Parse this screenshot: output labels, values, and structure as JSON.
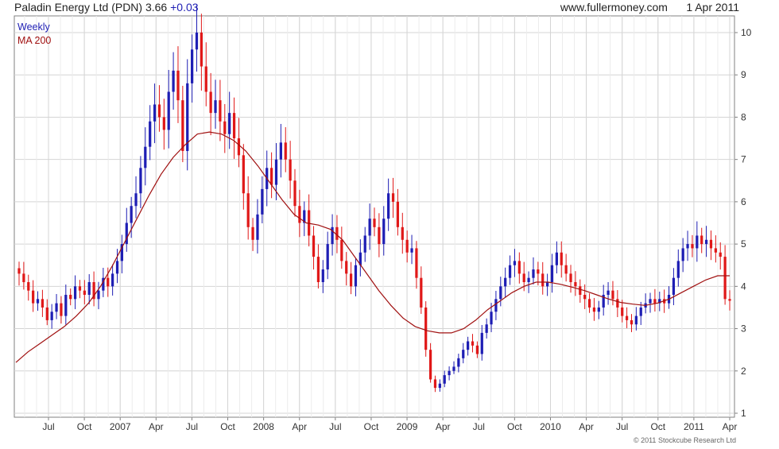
{
  "header": {
    "title": "Paladin Energy Ltd (PDN) 3.66",
    "change": "+0.03",
    "site": "www.fullermoney.com",
    "date": "1 Apr 2011"
  },
  "legend": {
    "weekly": "Weekly",
    "ma": "MA 200"
  },
  "copyright": "© 2011 Stockcube Research Ltd",
  "colors": {
    "up": "#1e1eb4",
    "down": "#e01818",
    "ma": "#a01010",
    "grid": "#d4d4d4",
    "frame": "#808080"
  },
  "chart_data": {
    "type": "candlestick",
    "x_range": [
      "2006-04",
      "2011-04"
    ],
    "ylim": [
      1,
      10
    ],
    "y_ticks": [
      1,
      2,
      3,
      4,
      5,
      6,
      7,
      8,
      9,
      10
    ],
    "x_tick_labels": [
      "Jul",
      "Oct",
      "2007",
      "Apr",
      "Jul",
      "Oct",
      "2008",
      "Apr",
      "Jul",
      "Oct",
      "2009",
      "Apr",
      "Jul",
      "Oct",
      "2010",
      "Apr",
      "Jul",
      "Oct",
      "2011",
      "Apr"
    ],
    "series": [
      {
        "name": "Weekly",
        "style": "candles",
        "closes": [
          4.3,
          4.1,
          3.9,
          3.6,
          3.7,
          3.5,
          3.2,
          3.4,
          3.6,
          3.3,
          3.8,
          3.7,
          4.0,
          3.9,
          3.8,
          4.1,
          3.7,
          3.9,
          4.2,
          4.0,
          4.3,
          4.6,
          5.0,
          5.5,
          5.9,
          6.2,
          6.8,
          7.3,
          7.9,
          8.3,
          8.0,
          7.7,
          8.6,
          9.1,
          8.4,
          7.2,
          8.8,
          9.6,
          10.0,
          9.2,
          8.6,
          8.1,
          8.4,
          7.9,
          7.6,
          8.1,
          7.5,
          7.1,
          6.2,
          5.4,
          5.1,
          5.7,
          6.3,
          6.8,
          6.4,
          7.0,
          7.4,
          7.0,
          6.5,
          5.9,
          5.5,
          5.8,
          5.2,
          4.7,
          4.1,
          4.4,
          5.0,
          5.4,
          5.1,
          4.6,
          4.3,
          4.0,
          4.5,
          4.8,
          5.2,
          5.6,
          5.4,
          5.0,
          5.6,
          6.2,
          6.0,
          5.4,
          5.1,
          4.8,
          4.9,
          4.2,
          3.5,
          2.5,
          1.8,
          1.6,
          1.7,
          1.9,
          2.0,
          2.1,
          2.3,
          2.5,
          2.7,
          2.6,
          2.4,
          2.9,
          3.1,
          3.4,
          3.7,
          4.0,
          4.2,
          4.5,
          4.6,
          4.3,
          4.1,
          4.2,
          4.4,
          4.3,
          4.0,
          4.1,
          4.5,
          4.8,
          4.5,
          4.3,
          4.1,
          4.0,
          3.8,
          3.7,
          3.5,
          3.4,
          3.5,
          3.8,
          3.9,
          3.7,
          3.5,
          3.3,
          3.2,
          3.1,
          3.3,
          3.5,
          3.6,
          3.7,
          3.6,
          3.7,
          3.6,
          3.8,
          4.2,
          4.6,
          4.9,
          5.0,
          4.9,
          5.2,
          5.0,
          5.1,
          4.9,
          4.8,
          4.7,
          3.7,
          3.66
        ]
      },
      {
        "name": "MA 200",
        "style": "line",
        "values": [
          2.2,
          2.45,
          2.65,
          2.85,
          3.05,
          3.3,
          3.6,
          4.0,
          4.5,
          5.05,
          5.6,
          6.15,
          6.65,
          7.05,
          7.35,
          7.6,
          7.65,
          7.6,
          7.45,
          7.2,
          6.85,
          6.45,
          6.05,
          5.7,
          5.5,
          5.45,
          5.35,
          5.1,
          4.7,
          4.3,
          3.9,
          3.55,
          3.25,
          3.05,
          2.95,
          2.9,
          2.9,
          3.0,
          3.2,
          3.45,
          3.65,
          3.85,
          4.0,
          4.1,
          4.1,
          4.05,
          3.98,
          3.9,
          3.8,
          3.7,
          3.62,
          3.58,
          3.55,
          3.6,
          3.7,
          3.85,
          4.0,
          4.15,
          4.25,
          4.25
        ]
      }
    ]
  }
}
